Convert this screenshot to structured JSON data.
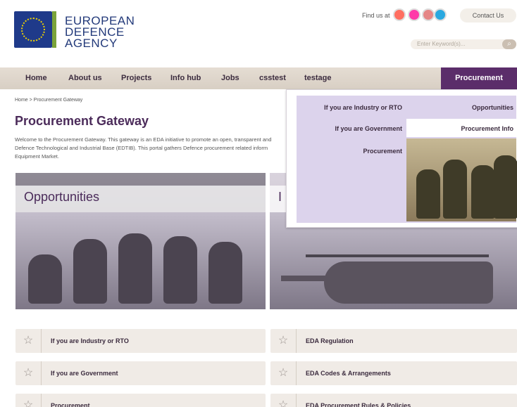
{
  "header": {
    "logo_lines": [
      "EUROPEAN",
      "DEFENCE",
      "AGENCY"
    ],
    "find_us_label": "Find us at",
    "contact_label": "Contact Us",
    "search_placeholder": "Enter Keyword(s)..."
  },
  "nav": {
    "items": [
      "Home",
      "About us",
      "Projects",
      "Info hub",
      "Jobs",
      "csstest",
      "testage"
    ],
    "active": "Procurement Gateway"
  },
  "breadcrumb": "Home  >  Procurement Gateway",
  "page": {
    "title": "Procurement Gateway",
    "intro_lines": [
      "Welcome to the Procurement Gateway. This gateway is an EDA initiative to promote an open, transparent and",
      "Defence Technological and Industrial Base (EDTIB). This portal gathers Defence procurement related inform",
      "Equipment Market."
    ]
  },
  "panels": {
    "left_label": "Opportunities",
    "right_label": "I"
  },
  "dropdown": {
    "left_items": [
      "If you are Industry or RTO",
      "If you are Government",
      "Procurement"
    ],
    "right_items": [
      "Opportunities",
      "Procurement Info"
    ]
  },
  "links": {
    "left": [
      "If you are Industry or RTO",
      "If you are Government",
      "Procurement"
    ],
    "right": [
      "EDA Regulation",
      "EDA Codes & Arrangements",
      "EDA Procurement Rules & Policies"
    ]
  },
  "colors": {
    "brand_purple": "#5b2d6a",
    "nav_bg": "#ddd4ca",
    "dropdown_bg": "#dcd3ec",
    "logo_blue": "#233a7a"
  }
}
